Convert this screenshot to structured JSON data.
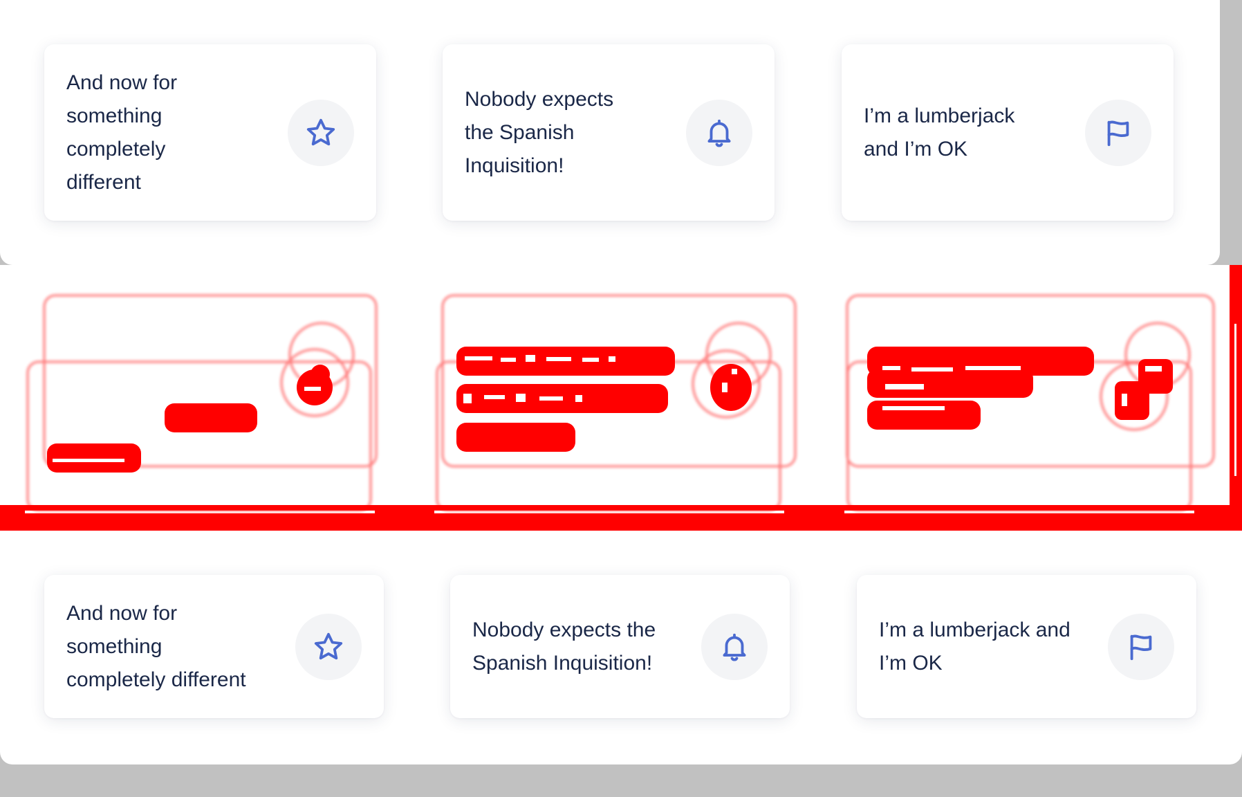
{
  "top_row": {
    "cards": [
      {
        "text_lines": [
          "And now for",
          "something",
          "completely",
          "different"
        ],
        "icon": "star-icon"
      },
      {
        "text_lines": [
          "Nobody expects",
          "the Spanish",
          "Inquisition!"
        ],
        "icon": "bell-icon"
      },
      {
        "text_lines": [
          "I’m a lumberjack",
          "and I’m OK"
        ],
        "icon": "flag-icon"
      }
    ]
  },
  "bottom_row": {
    "cards": [
      {
        "text_lines": [
          "And now for",
          "something",
          "completely different"
        ],
        "icon": "star-icon"
      },
      {
        "text_lines": [
          "Nobody expects the",
          "Spanish Inquisition!"
        ],
        "icon": "bell-icon"
      },
      {
        "text_lines": [
          "I’m a lumberjack and",
          "I’m OK"
        ],
        "icon": "flag-icon"
      }
    ]
  },
  "colors": {
    "text": "#1a2747",
    "icon": "#4a6ad0",
    "icon_bg": "#f3f4f6",
    "diff": "#ff0000",
    "backdrop": "#c1c1c1"
  }
}
